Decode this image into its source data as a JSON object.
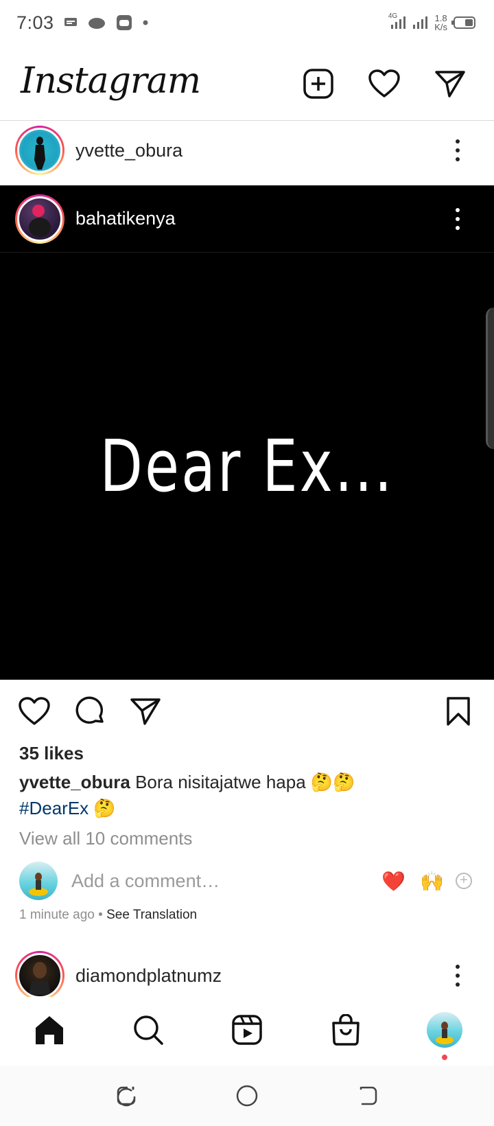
{
  "status_bar": {
    "time": "7:03",
    "network_type": "4G",
    "net_speed_value": "1.8",
    "net_speed_unit": "K/s"
  },
  "header": {
    "logo_text": "Instagram",
    "icons": [
      "new-post-icon",
      "heart-icon",
      "direct-message-icon"
    ]
  },
  "story_user": {
    "username": "yvette_obura"
  },
  "post": {
    "username": "bahatikenya",
    "media_text": "Dear Ex...",
    "likes_text": "35 likes",
    "caption_user": "yvette_obura",
    "caption_text": "Bora nisitajatwe hapa 🤔🤔",
    "hashtag": "#DearEx",
    "hashtag_emoji": "🤔",
    "view_comments": "View all 10 comments",
    "add_comment_placeholder": "Add a comment…",
    "quick_reactions": [
      "❤️",
      "🙌"
    ],
    "time_ago": "1 minute ago",
    "separator": " • ",
    "see_translation": "See Translation"
  },
  "next_post": {
    "username": "diamondplatnumz"
  },
  "bottom_nav": {
    "items": [
      "home-icon",
      "search-icon",
      "reels-icon",
      "shop-icon",
      "profile-avatar"
    ],
    "active": "home-icon",
    "notification_dot_color": "#ed4956"
  },
  "colors": {
    "hashtag": "#00376b",
    "muted": "#8e8e8e",
    "text": "#262626"
  }
}
